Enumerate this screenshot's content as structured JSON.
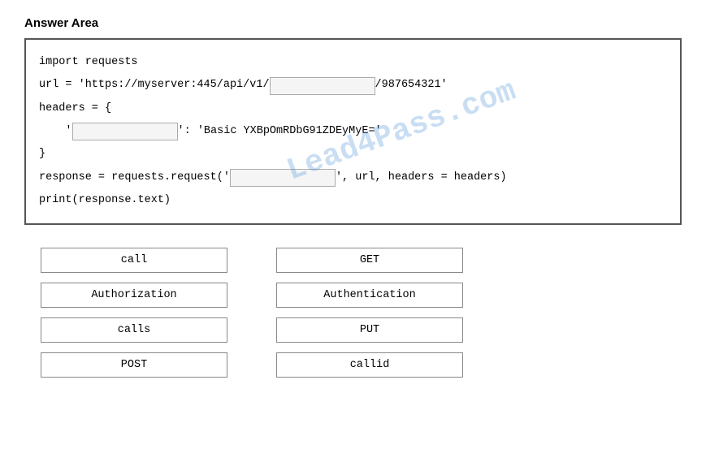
{
  "title": "Answer Area",
  "code": {
    "line1": "import requests",
    "line2_before": "url = 'https://myserver:445/api/v1/",
    "line2_blank": "",
    "line2_after": "/987654321'",
    "line3": "headers = {",
    "line4_indent": "    '",
    "line4_blank": "",
    "line4_after": "': 'Basic YXBpOmRDbG91ZDEyMyE='",
    "line5": "}",
    "line6_before": "response = requests.request('",
    "line6_blank": "",
    "line6_after": "', url, headers = headers)",
    "line7": "print(response.text)"
  },
  "watermark": "Lead4Pass.com",
  "options": [
    {
      "id": "call",
      "label": "call"
    },
    {
      "id": "GET",
      "label": "GET"
    },
    {
      "id": "Authorization",
      "label": "Authorization"
    },
    {
      "id": "Authentication",
      "label": "Authentication"
    },
    {
      "id": "calls",
      "label": "calls"
    },
    {
      "id": "PUT",
      "label": "PUT"
    },
    {
      "id": "POST",
      "label": "POST"
    },
    {
      "id": "callid",
      "label": "callid"
    }
  ]
}
